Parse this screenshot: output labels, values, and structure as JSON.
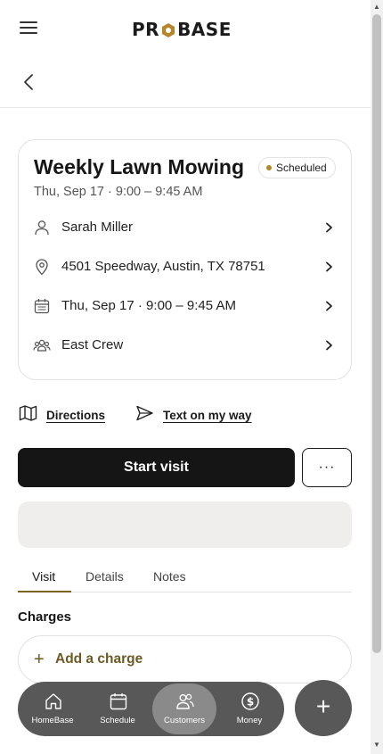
{
  "app": {
    "logo_prefix": "PR",
    "logo_suffix": "BASE",
    "brand_color": "#b5862a"
  },
  "visit": {
    "title": "Weekly Lawn Mowing",
    "status": "Scheduled",
    "subtitle": "Thu, Sep 17 · 9:00 – 9:45 AM",
    "customer": "Sarah Miller",
    "address": "4501 Speedway, Austin, TX 78751",
    "schedule": "Thu, Sep 17 · 9:00 – 9:45 AM",
    "crew": "East Crew"
  },
  "actions": {
    "directions": "Directions",
    "text_on_my_way": "Text on my way",
    "start_visit": "Start visit",
    "more": "···"
  },
  "tabs": [
    {
      "label": "Visit",
      "active": true
    },
    {
      "label": "Details",
      "active": false
    },
    {
      "label": "Notes",
      "active": false
    }
  ],
  "charges": {
    "heading": "Charges",
    "add_label": "Add a charge",
    "add_icon": "+"
  },
  "bottom_nav": [
    {
      "label": "HomeBase",
      "icon": "home-icon",
      "active": false
    },
    {
      "label": "Schedule",
      "icon": "calendar-icon",
      "active": false
    },
    {
      "label": "Customers",
      "icon": "customers-icon",
      "active": true
    },
    {
      "label": "Money",
      "icon": "dollar-icon",
      "active": false
    }
  ],
  "fab_icon": "+",
  "colors": {
    "accent": "#7a6424",
    "dark": "#151515",
    "nav_bg": "#585858",
    "nav_active": "#8a8a8a"
  }
}
